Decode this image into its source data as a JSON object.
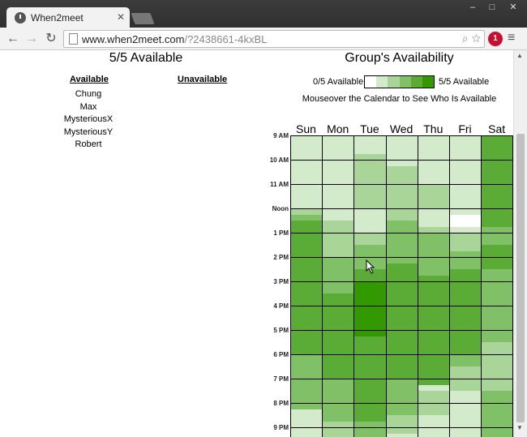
{
  "browser": {
    "tab_title": "When2meet",
    "tab_close": "✕",
    "url_host": "www.when2meet.com",
    "url_rest": "/?2438661-4kxBL",
    "back_glyph": "←",
    "forward_glyph": "→",
    "reload_glyph": "↻",
    "search_glyph": "⌕",
    "star_glyph": "☆",
    "menu_glyph": "≡",
    "minimize_glyph": "‒",
    "maximize_glyph": "□",
    "close_glyph": "✕",
    "extension_badge": "1"
  },
  "left_panel": {
    "title": "5/5 Available",
    "available_header": "Available",
    "unavailable_header": "Unavailable",
    "available_people": [
      "Chung",
      "Max",
      "MysteriousX",
      "MysteriousY",
      "Robert"
    ]
  },
  "right_panel": {
    "title": "Group's Availability",
    "legend_min": "0/5 Available",
    "legend_max": "5/5 Available",
    "hint": "Mouseover the Calendar to See Who Is Available"
  },
  "calendar": {
    "days": [
      "Sun",
      "Mon",
      "Tue",
      "Wed",
      "Thu",
      "Fri",
      "Sat"
    ],
    "times": [
      "9 AM",
      "10 AM",
      "11 AM",
      "Noon",
      "1 PM",
      "2 PM",
      "3 PM",
      "4 PM",
      "5 PM",
      "6 PM",
      "7 PM",
      "8 PM",
      "9 PM"
    ],
    "colors": [
      "#ffffff",
      "#d4ebcb",
      "#aad599",
      "#80c066",
      "#5aac36",
      "#339900"
    ],
    "availability_counts": [
      [
        1,
        1,
        1,
        1,
        1,
        1,
        1,
        1,
        1,
        1,
        1,
        1,
        2,
        3,
        4,
        4,
        4,
        4,
        4,
        4,
        4,
        4,
        4,
        4,
        4,
        4,
        4,
        4,
        4,
        4,
        4,
        4,
        4,
        4,
        4,
        4,
        3,
        3,
        3,
        3,
        3,
        3,
        3,
        3,
        3,
        1,
        1,
        1,
        1,
        1,
        1,
        1
      ],
      [
        1,
        1,
        1,
        1,
        1,
        1,
        1,
        1,
        1,
        1,
        1,
        1,
        1,
        1,
        2,
        2,
        2,
        2,
        2,
        2,
        3,
        3,
        3,
        3,
        3,
        3,
        4,
        4,
        4,
        4,
        4,
        4,
        4,
        4,
        4,
        4,
        4,
        4,
        4,
        4,
        3,
        3,
        3,
        3,
        3,
        3,
        3,
        2,
        2,
        2,
        2,
        2
      ],
      [
        1,
        1,
        1,
        2,
        2,
        2,
        2,
        2,
        2,
        2,
        2,
        2,
        1,
        1,
        1,
        1,
        2,
        2,
        3,
        3,
        3,
        3,
        4,
        4,
        5,
        5,
        5,
        5,
        5,
        5,
        5,
        5,
        5,
        4,
        4,
        4,
        4,
        4,
        4,
        4,
        4,
        4,
        4,
        4,
        4,
        4,
        4,
        3,
        3,
        3,
        3,
        3
      ],
      [
        1,
        1,
        1,
        1,
        1,
        2,
        2,
        2,
        2,
        2,
        2,
        2,
        2,
        2,
        3,
        3,
        3,
        3,
        3,
        3,
        3,
        4,
        4,
        4,
        4,
        4,
        4,
        4,
        4,
        4,
        4,
        4,
        4,
        4,
        4,
        4,
        4,
        4,
        4,
        4,
        3,
        3,
        3,
        3,
        3,
        3,
        2,
        2,
        2,
        1,
        1,
        1
      ],
      [
        1,
        1,
        1,
        1,
        1,
        1,
        1,
        1,
        2,
        2,
        2,
        2,
        1,
        1,
        1,
        2,
        3,
        3,
        3,
        3,
        3,
        3,
        3,
        4,
        4,
        4,
        4,
        4,
        4,
        4,
        4,
        4,
        4,
        4,
        4,
        4,
        4,
        4,
        4,
        4,
        4,
        1,
        2,
        2,
        2,
        2,
        1,
        1,
        1,
        1,
        1,
        1
      ],
      [
        1,
        1,
        1,
        1,
        1,
        1,
        1,
        1,
        1,
        1,
        1,
        1,
        1,
        0,
        0,
        1,
        2,
        2,
        2,
        3,
        3,
        3,
        4,
        4,
        4,
        4,
        4,
        4,
        4,
        4,
        4,
        4,
        4,
        4,
        4,
        4,
        3,
        3,
        2,
        2,
        2,
        2,
        1,
        1,
        1,
        1,
        1,
        1,
        1,
        1,
        1,
        1
      ],
      [
        4,
        4,
        4,
        4,
        4,
        4,
        4,
        4,
        4,
        4,
        4,
        4,
        4,
        4,
        4,
        3,
        3,
        3,
        4,
        4,
        4,
        4,
        3,
        3,
        3,
        3,
        3,
        3,
        3,
        3,
        3,
        3,
        3,
        3,
        2,
        2,
        2,
        2,
        2,
        2,
        2,
        2,
        3,
        3,
        3,
        3,
        3,
        3,
        3,
        3,
        2,
        2
      ]
    ]
  }
}
